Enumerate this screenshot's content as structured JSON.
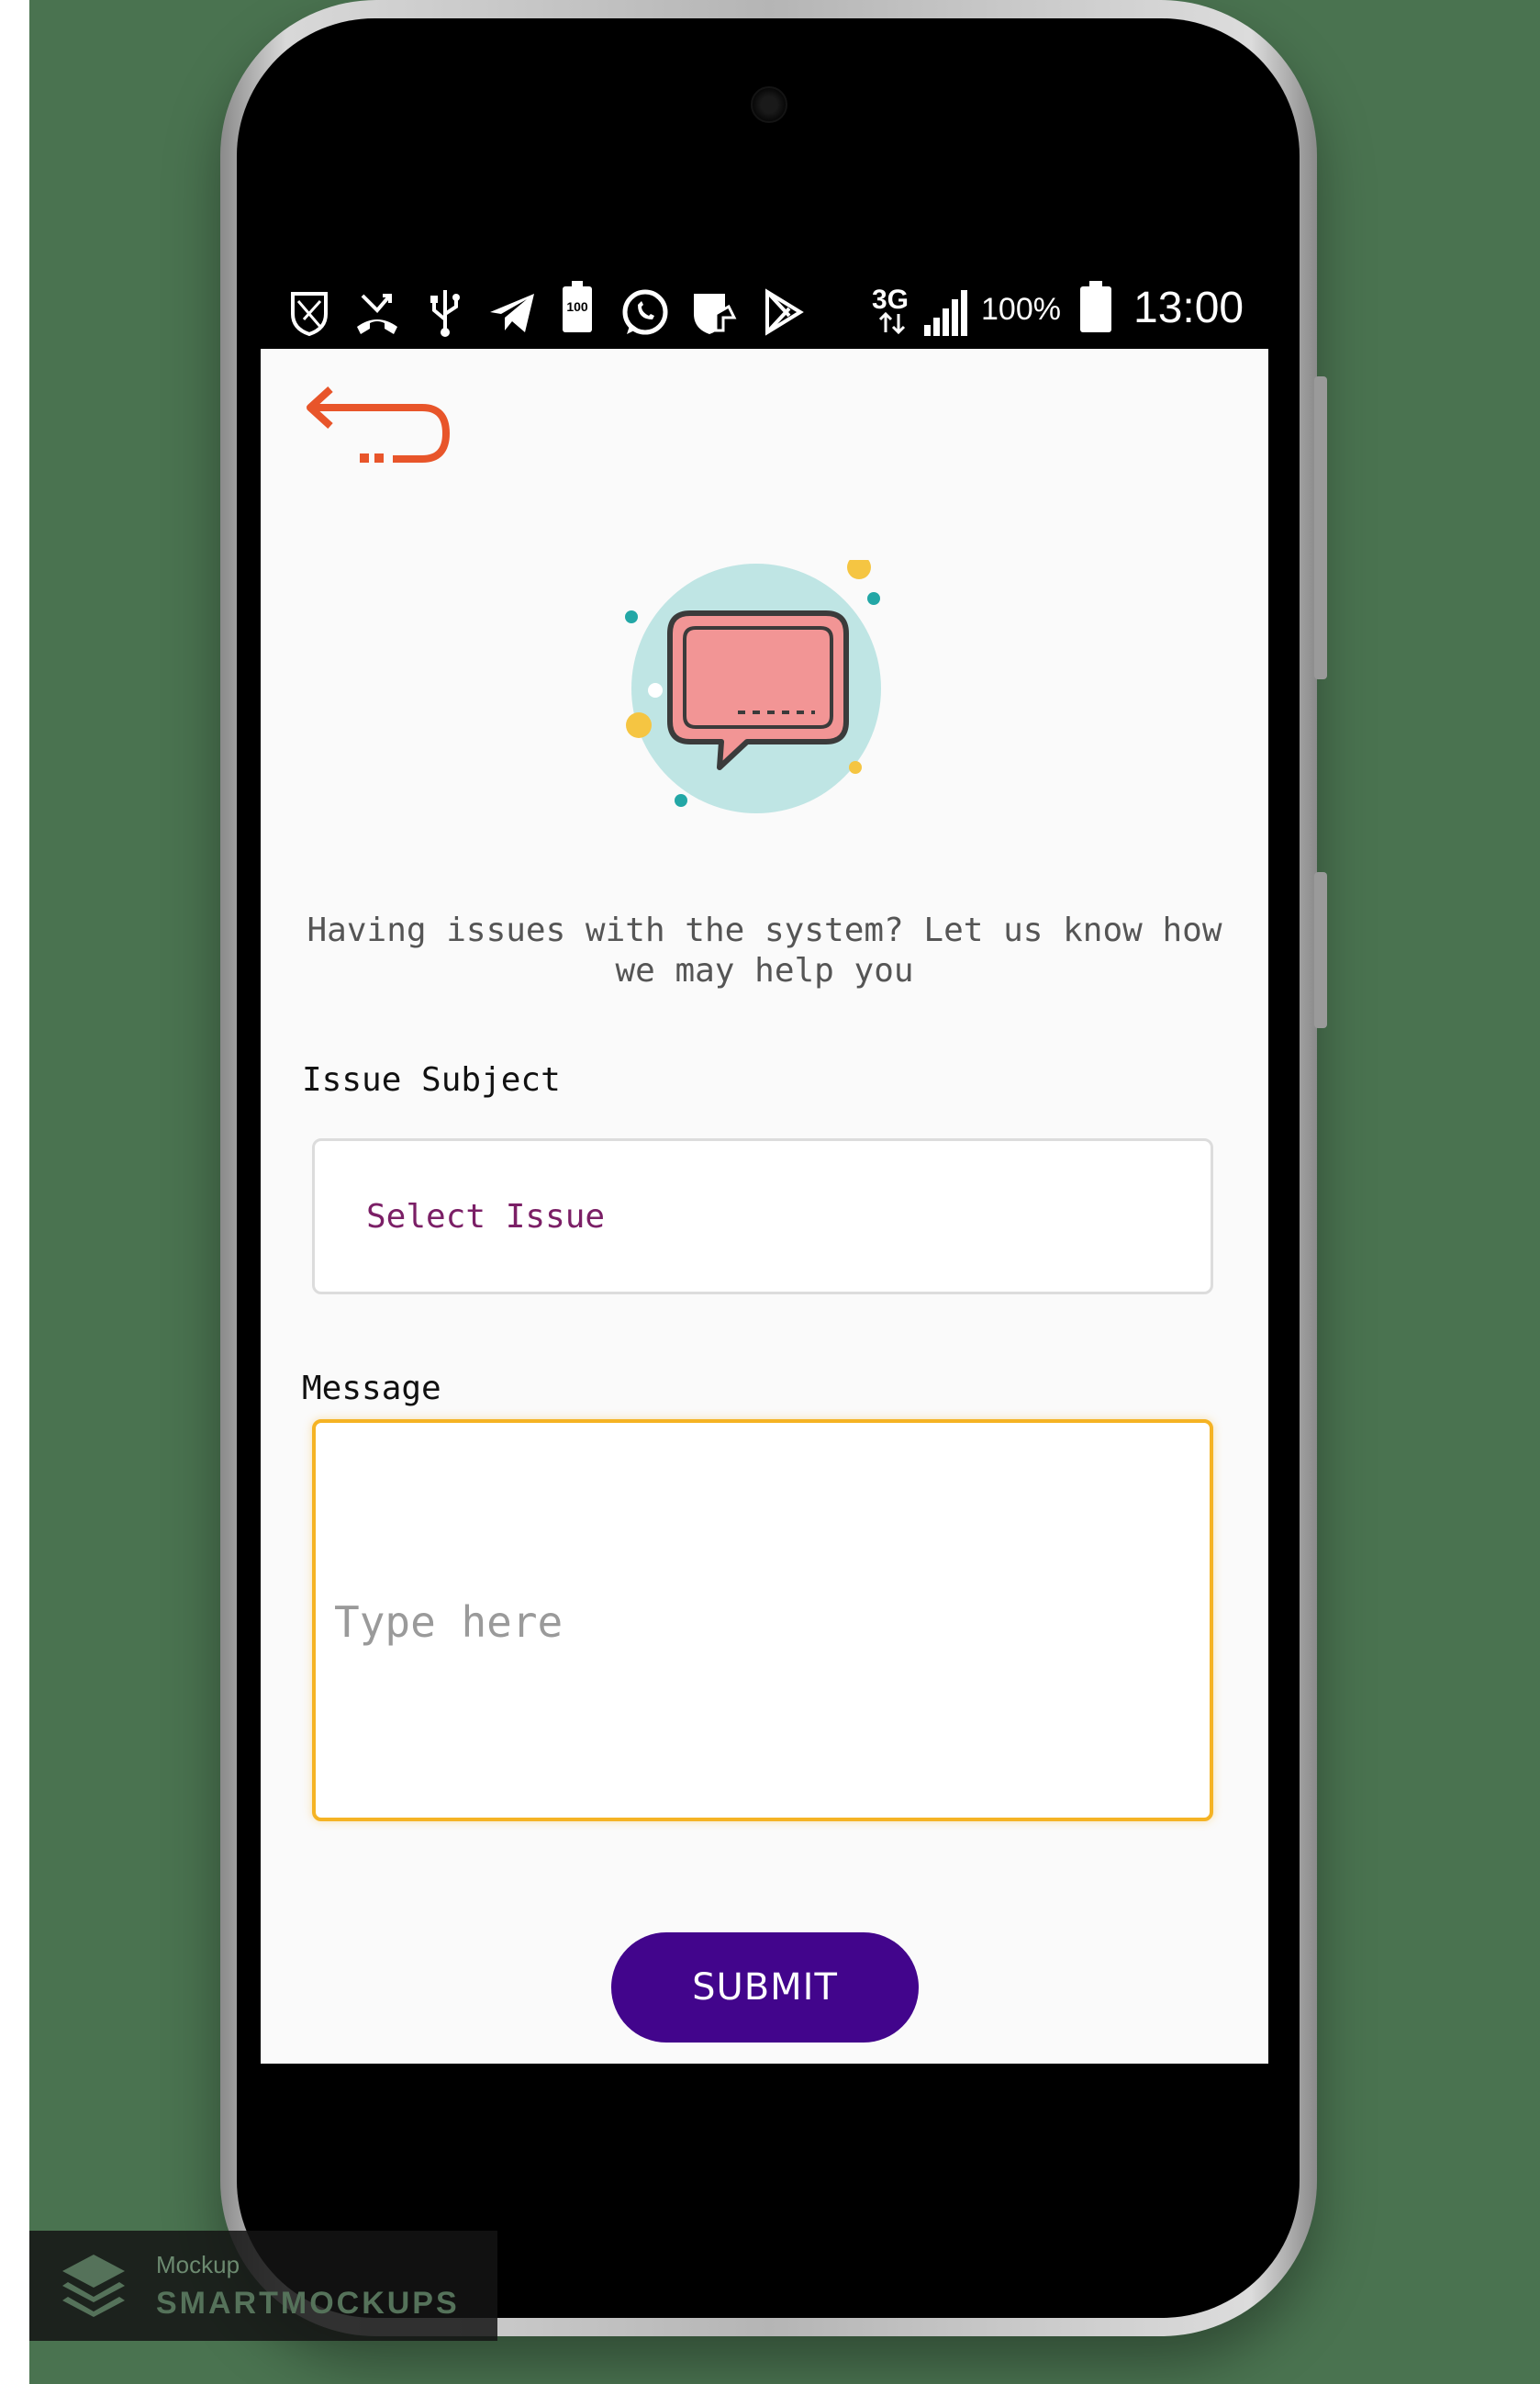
{
  "status_bar": {
    "network": "3G",
    "battery_small": "100",
    "battery_percent": "100%",
    "time": "13:00",
    "icons": [
      "shield-outline-icon",
      "missed-call-icon",
      "usb-icon",
      "telegram-icon",
      "battery-saver-icon",
      "whatsapp-icon",
      "vpn-shield-icon",
      "play-store-icon"
    ]
  },
  "app": {
    "back_icon": "back-arrow-icon",
    "illustration_icon": "chat-bubble-icon",
    "intro_text": "Having issues with the system? Let us know how we may help you",
    "subject_label": "Issue Subject",
    "subject_placeholder": "Select Issue",
    "message_label": "Message",
    "message_placeholder": "Type here",
    "submit_label": "SUBMIT"
  },
  "watermark": {
    "line1": "Mockup",
    "line2": "SMARTMOCKUPS"
  },
  "colors": {
    "accent_orange": "#e8552a",
    "primary_purple": "#42058c",
    "select_text": "#7b1f66",
    "focus_border": "#f5b324",
    "bubble_fill": "#f29595",
    "circle_fill": "#bfe5e4"
  }
}
